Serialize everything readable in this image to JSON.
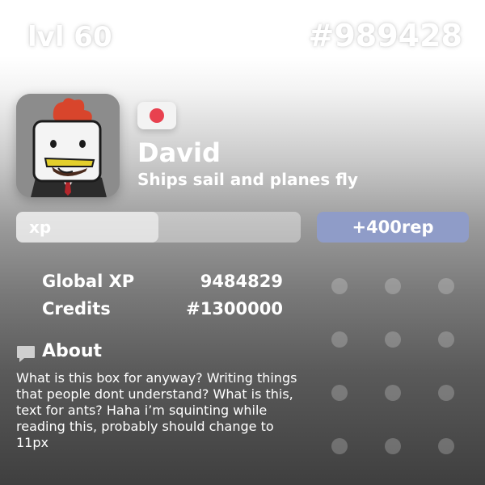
{
  "header": {
    "level": "lvl 60",
    "user_id": "#989428"
  },
  "profile": {
    "avatar_icon": "chicken-avatar-icon",
    "country_flag": "japan-flag-icon",
    "flag_color": "#e8414f",
    "name": "David",
    "tagline": "Ships sail and planes fly"
  },
  "xp": {
    "label": "xp",
    "progress_fraction": 0.5
  },
  "rep_button": {
    "label": "+400rep",
    "color": "#8f9cc8"
  },
  "stats": [
    {
      "label": "Global XP",
      "value": "9484829"
    },
    {
      "label": "Credits",
      "value": "#1300000"
    }
  ],
  "about": {
    "icon": "speech-bubble-icon",
    "title": "About",
    "text": "What is this box for anyway? Writing things that people dont understand? What is this, text for ants? Haha i’m squinting while reading this, probably should change to 11px"
  }
}
